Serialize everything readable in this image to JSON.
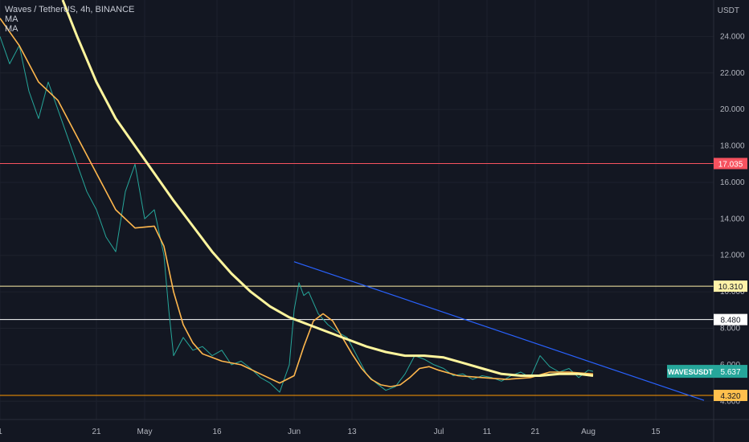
{
  "header": {
    "symbol_title": "Waves / TetherUS, 4h, BINANCE",
    "indicators": [
      "MA",
      "MA"
    ]
  },
  "chart_data": {
    "type": "line",
    "title": "Waves / TetherUS, 4h, BINANCE",
    "y_unit": "USDT",
    "ylim": [
      3.0,
      26.0
    ],
    "y_ticks": [
      {
        "value": 24,
        "label": "24.000"
      },
      {
        "value": 22,
        "label": "22.000"
      },
      {
        "value": 20,
        "label": "20.000"
      },
      {
        "value": 18,
        "label": "18.000"
      },
      {
        "value": 16,
        "label": "16.000"
      },
      {
        "value": 14,
        "label": "14.000"
      },
      {
        "value": 12,
        "label": "12.000"
      },
      {
        "value": 10,
        "label": "10.000"
      },
      {
        "value": 8,
        "label": "8.000"
      },
      {
        "value": 6,
        "label": "6.000"
      },
      {
        "value": 4,
        "label": "4.000"
      }
    ],
    "x_ticks": [
      {
        "day": 0,
        "label": "1"
      },
      {
        "day": 20,
        "label": "21"
      },
      {
        "day": 30,
        "label": "May"
      },
      {
        "day": 45,
        "label": "16"
      },
      {
        "day": 61,
        "label": "Jun"
      },
      {
        "day": 73,
        "label": "13"
      },
      {
        "day": 91,
        "label": "Jul"
      },
      {
        "day": 101,
        "label": "11"
      },
      {
        "day": 111,
        "label": "21"
      },
      {
        "day": 122,
        "label": "Aug"
      },
      {
        "day": 136,
        "label": "15"
      }
    ],
    "xlim": [
      0,
      148
    ],
    "horizontal_levels": [
      {
        "value": 17.035,
        "label": "17.035",
        "color": "#f7525f",
        "bg": "#f7525f",
        "fg": "#ffffff"
      },
      {
        "value": 10.31,
        "label": "10.310",
        "color": "#fff2a8",
        "bg": "#fff2a8",
        "fg": "#131722"
      },
      {
        "value": 8.48,
        "label": "8.480",
        "color": "#ffffff",
        "bg": "#ffffff",
        "fg": "#131722"
      },
      {
        "value": 4.32,
        "label": "4.320",
        "color": "#ff9800",
        "bg": "#ffc04d",
        "fg": "#131722"
      }
    ],
    "price_badge": {
      "name": "WAVESUSDT",
      "value": "5.637",
      "color": "#26a69a"
    },
    "trendline": {
      "color": "#2962ff",
      "points": [
        [
          61,
          11.65
        ],
        [
          146,
          4.05
        ]
      ]
    },
    "series": [
      {
        "key": "price",
        "color": "#26a69a",
        "points": [
          [
            0,
            24.0
          ],
          [
            2,
            22.5
          ],
          [
            4,
            23.5
          ],
          [
            6,
            21.0
          ],
          [
            8,
            19.5
          ],
          [
            10,
            21.5
          ],
          [
            12,
            20.0
          ],
          [
            14,
            18.5
          ],
          [
            16,
            17.0
          ],
          [
            18,
            15.5
          ],
          [
            20,
            14.5
          ],
          [
            22,
            13.0
          ],
          [
            24,
            12.2
          ],
          [
            26,
            15.5
          ],
          [
            28,
            17.0
          ],
          [
            30,
            14.0
          ],
          [
            32,
            14.5
          ],
          [
            34,
            12.0
          ],
          [
            35,
            9.0
          ],
          [
            36,
            6.5
          ],
          [
            38,
            7.5
          ],
          [
            40,
            6.8
          ],
          [
            42,
            7.0
          ],
          [
            44,
            6.5
          ],
          [
            46,
            6.8
          ],
          [
            48,
            6.0
          ],
          [
            50,
            6.2
          ],
          [
            52,
            5.8
          ],
          [
            54,
            5.3
          ],
          [
            56,
            5.0
          ],
          [
            58,
            4.5
          ],
          [
            60,
            6.0
          ],
          [
            61,
            9.0
          ],
          [
            62,
            10.5
          ],
          [
            63,
            9.8
          ],
          [
            64,
            10.0
          ],
          [
            66,
            8.8
          ],
          [
            68,
            8.2
          ],
          [
            70,
            7.8
          ],
          [
            72,
            7.5
          ],
          [
            74,
            6.5
          ],
          [
            76,
            5.5
          ],
          [
            78,
            5.0
          ],
          [
            80,
            4.6
          ],
          [
            82,
            4.8
          ],
          [
            84,
            5.5
          ],
          [
            86,
            6.5
          ],
          [
            88,
            6.3
          ],
          [
            90,
            6.0
          ],
          [
            92,
            5.8
          ],
          [
            94,
            5.4
          ],
          [
            96,
            5.5
          ],
          [
            98,
            5.2
          ],
          [
            100,
            5.4
          ],
          [
            102,
            5.3
          ],
          [
            104,
            5.1
          ],
          [
            106,
            5.4
          ],
          [
            108,
            5.6
          ],
          [
            110,
            5.3
          ],
          [
            112,
            6.5
          ],
          [
            114,
            5.9
          ],
          [
            116,
            5.6
          ],
          [
            118,
            5.8
          ],
          [
            120,
            5.3
          ],
          [
            122,
            5.7
          ],
          [
            123,
            5.64
          ]
        ]
      },
      {
        "key": "ma-fast",
        "color": "#ffb74d",
        "points": [
          [
            0,
            25.0
          ],
          [
            4,
            23.5
          ],
          [
            8,
            21.5
          ],
          [
            12,
            20.5
          ],
          [
            16,
            18.5
          ],
          [
            20,
            16.5
          ],
          [
            24,
            14.5
          ],
          [
            28,
            13.5
          ],
          [
            32,
            13.6
          ],
          [
            34,
            12.5
          ],
          [
            36,
            10.0
          ],
          [
            38,
            8.2
          ],
          [
            40,
            7.2
          ],
          [
            42,
            6.6
          ],
          [
            44,
            6.4
          ],
          [
            46,
            6.2
          ],
          [
            50,
            6.0
          ],
          [
            54,
            5.5
          ],
          [
            58,
            5.0
          ],
          [
            61,
            5.4
          ],
          [
            63,
            7.0
          ],
          [
            65,
            8.4
          ],
          [
            67,
            8.8
          ],
          [
            69,
            8.4
          ],
          [
            71,
            7.5
          ],
          [
            73,
            6.6
          ],
          [
            75,
            5.8
          ],
          [
            77,
            5.2
          ],
          [
            79,
            4.9
          ],
          [
            81,
            4.8
          ],
          [
            83,
            4.9
          ],
          [
            85,
            5.3
          ],
          [
            87,
            5.8
          ],
          [
            89,
            5.9
          ],
          [
            91,
            5.7
          ],
          [
            95,
            5.4
          ],
          [
            100,
            5.3
          ],
          [
            105,
            5.2
          ],
          [
            110,
            5.3
          ],
          [
            114,
            5.6
          ],
          [
            118,
            5.6
          ],
          [
            123,
            5.5
          ]
        ]
      },
      {
        "key": "ma-slow",
        "color": "#fff59d",
        "points": [
          [
            13,
            26.0
          ],
          [
            16,
            24.0
          ],
          [
            20,
            21.5
          ],
          [
            24,
            19.5
          ],
          [
            28,
            18.0
          ],
          [
            32,
            16.5
          ],
          [
            36,
            15.0
          ],
          [
            40,
            13.6
          ],
          [
            44,
            12.2
          ],
          [
            48,
            11.0
          ],
          [
            52,
            10.0
          ],
          [
            56,
            9.2
          ],
          [
            60,
            8.6
          ],
          [
            64,
            8.2
          ],
          [
            68,
            7.8
          ],
          [
            72,
            7.4
          ],
          [
            76,
            7.0
          ],
          [
            80,
            6.7
          ],
          [
            84,
            6.5
          ],
          [
            88,
            6.5
          ],
          [
            92,
            6.4
          ],
          [
            96,
            6.1
          ],
          [
            100,
            5.8
          ],
          [
            104,
            5.5
          ],
          [
            108,
            5.4
          ],
          [
            112,
            5.4
          ],
          [
            116,
            5.5
          ],
          [
            120,
            5.5
          ],
          [
            123,
            5.4
          ]
        ]
      }
    ]
  }
}
